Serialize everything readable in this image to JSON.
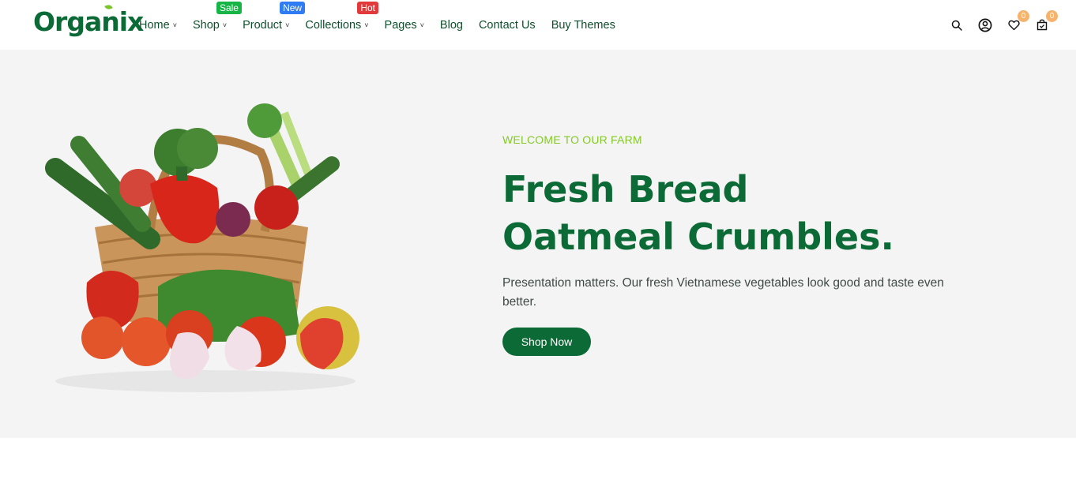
{
  "header": {
    "logo": "Organix",
    "nav": [
      {
        "label": "Home",
        "chevron": true,
        "badge": ""
      },
      {
        "label": "Shop",
        "chevron": true,
        "badge": "Sale"
      },
      {
        "label": "Product",
        "chevron": true,
        "badge": "New"
      },
      {
        "label": "Collections",
        "chevron": true,
        "badge": "Hot"
      },
      {
        "label": "Pages",
        "chevron": true,
        "badge": ""
      },
      {
        "label": "Blog",
        "chevron": false,
        "badge": ""
      },
      {
        "label": "Contact Us",
        "chevron": false,
        "badge": ""
      },
      {
        "label": "Buy Themes",
        "chevron": false,
        "badge": ""
      }
    ],
    "icons": {
      "search": "search-icon",
      "account": "user-circle-icon",
      "wishlist": "heart-icon",
      "wishlist_count": "0",
      "cart": "cart-icon",
      "cart_count": "0"
    }
  },
  "hero": {
    "eyebrow": "WELCOME TO OUR FARM",
    "title_line1": "Fresh Bread",
    "title_line2": "Oatmeal Crumbles.",
    "description": "Presentation matters. Our fresh Vietnamese vegetables look good and taste even better.",
    "button": "Shop Now",
    "image": "vegetable-basket-image"
  },
  "colors": {
    "brand_green": "#0b6a35",
    "accent_lime": "#84c926",
    "sale": "#17b546",
    "new": "#2f7bf3",
    "hot": "#e23a3a",
    "count_badge": "#f7b36b",
    "hero_bg": "#f4f4f4"
  }
}
